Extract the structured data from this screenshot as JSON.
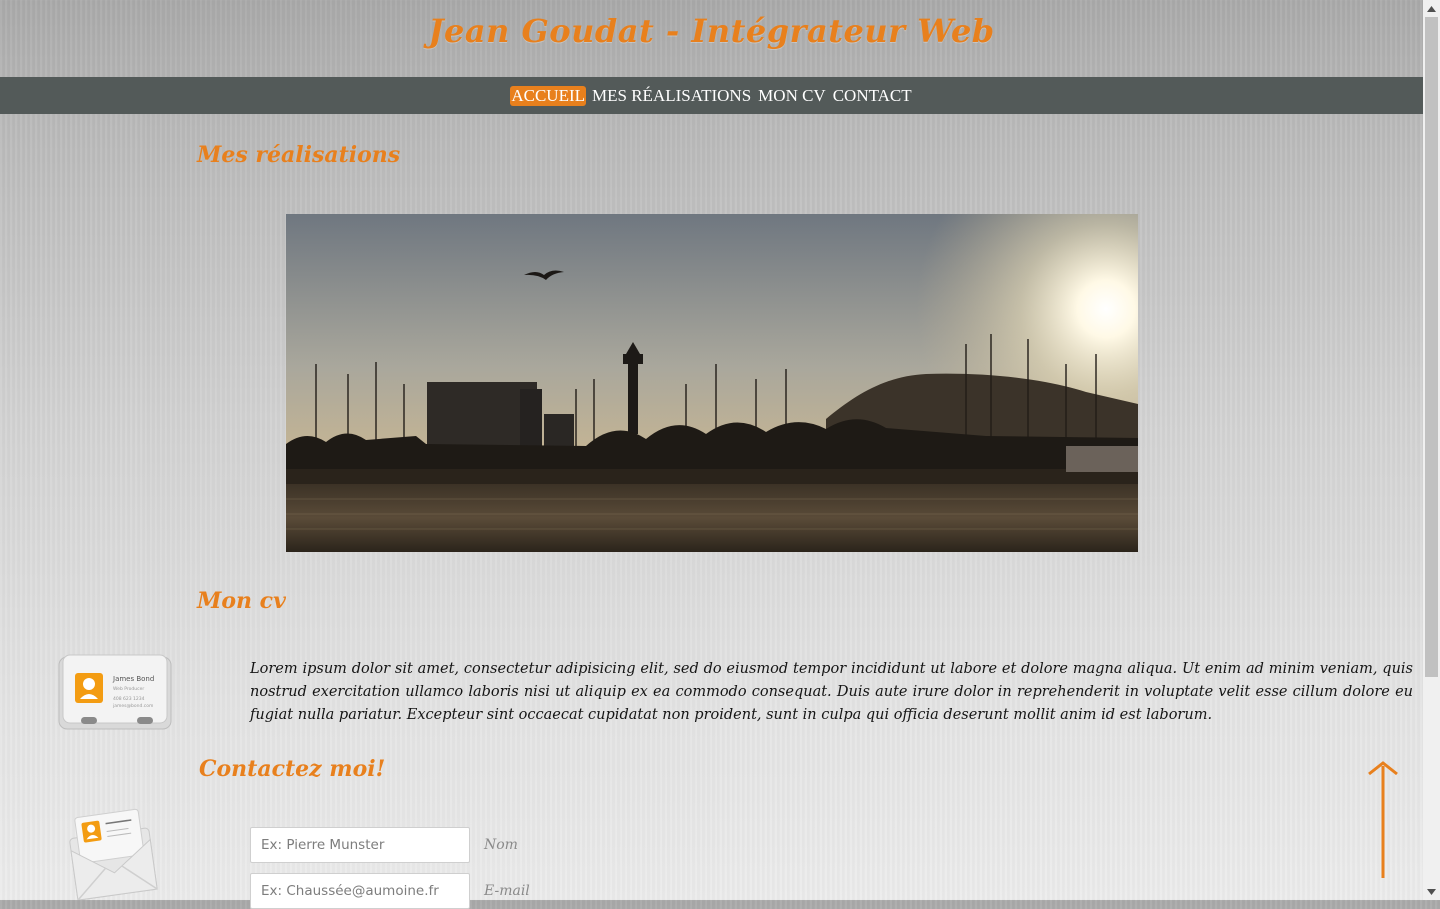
{
  "site": {
    "title": "Jean Goudat - Intégrateur Web"
  },
  "nav": {
    "items": [
      {
        "label": "ACCUEIL",
        "active": true
      },
      {
        "label": "MES RÉALISATIONS",
        "active": false
      },
      {
        "label": "MON CV",
        "active": false
      },
      {
        "label": "CONTACT",
        "active": false
      }
    ]
  },
  "realisations": {
    "title": "Mes réalisations"
  },
  "cv": {
    "title": "Mon cv",
    "card_name": "James Bond",
    "card_role": "Web Producer",
    "card_phone": "408 623 1234",
    "card_email": "james@bond.com",
    "text": "Lorem ipsum dolor sit amet, consectetur adipisicing elit, sed do eiusmod tempor incididunt ut labore et dolore magna aliqua. Ut enim ad minim veniam, quis nostrud exercitation ullamco laboris nisi ut aliquip ex ea commodo consequat. Duis aute irure dolor in reprehenderit in voluptate velit esse cillum dolore eu fugiat nulla pariatur. Excepteur sint occaecat cupidatat non proident, sunt in culpa qui officia deserunt mollit anim id est laborum."
  },
  "contact": {
    "title": "Contactez moi!",
    "name_placeholder": "Ex: Pierre Munster",
    "name_label": "Nom",
    "email_placeholder": "Ex: Chaussée@aumoine.fr",
    "email_label": "E-mail"
  },
  "colors": {
    "accent": "#e8801d",
    "nav_bg": "#535a59"
  }
}
